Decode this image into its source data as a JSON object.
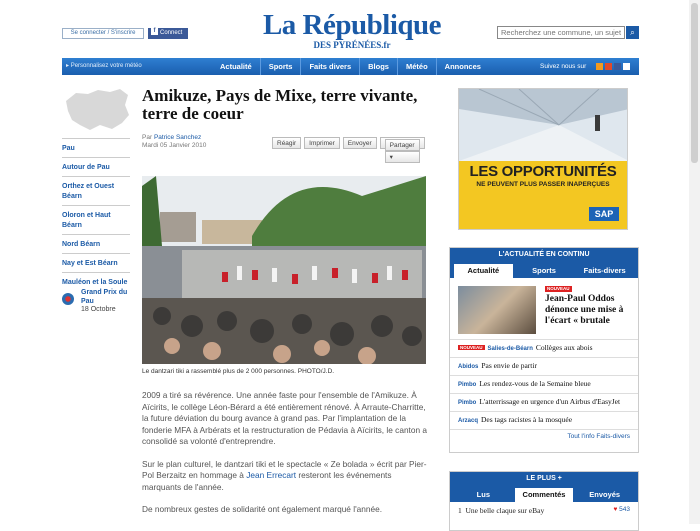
{
  "header": {
    "connect_label": "Se connecter / S'inscrire",
    "fb_connect_label": "Connect",
    "logo_main": "La République",
    "logo_sub": "DES PYRÉNÉES.fr",
    "search_placeholder": "Recherchez une commune, un sujet"
  },
  "nav": {
    "meteo_label": "Personnalisez votre météo",
    "items": [
      "Actualité",
      "Sports",
      "Faits divers",
      "Blogs",
      "Météo",
      "Annonces"
    ],
    "follow_label": "Suivez nous sur"
  },
  "leftnav": {
    "items": [
      "Pau",
      "Autour de Pau",
      "Orthez et Ouest Béarn",
      "Oloron et Haut Béarn",
      "Nord Béarn",
      "Nay et Est Béarn",
      "Mauléon et la Soule"
    ],
    "event_title": "Grand Prix du Pau",
    "event_date": "18 Octobre"
  },
  "article": {
    "title": "Amikuze, Pays de Mixe, terre vivante, terre de coeur",
    "author_prefix": "Par",
    "author": "Patrice Sanchez",
    "date": "Mardi 05 Janvier 2010",
    "tools": [
      "Réagir",
      "Imprimer",
      "Envoyer",
      "Partager"
    ],
    "caption": "Le dantzari tiki a rassemblé plus de 2 000 personnes. PHOTO/J.D.",
    "p1": "2009 a tiré sa révérence. Une année faste pour l'ensemble de l'Amikuze. À Aïcirits, le collège Léon-Bérard a été entièrement rénové. À Arraute-Charritte, la future déviation du bourg avance à grand pas. Par l'implantation de la fonderie MFA à Arbérats et la restructuration de Pédavia à Aïcirits, le canton a consolidé sa volonté d'entreprendre.",
    "p2_a": "Sur le plan culturel, le dantzari tiki et le spectacle « Ze bolada » écrit par Pier-Pol Berzaitz en hommage à ",
    "p2_link": "Jean Errecart",
    "p2_b": " resteront les événements marquants de l'année.",
    "p3": "De nombreux gestes de solidarité ont également marqué l'année."
  },
  "ad": {
    "title": "LES OPPORTUNITÉS",
    "subtitle": "NE PEUVENT PLUS PASSER INAPERÇUES",
    "brand": "SAP"
  },
  "news_box": {
    "header": "L'ACTUALITÉ EN CONTINU",
    "tabs": [
      "Actualité",
      "Sports",
      "Faits-divers"
    ],
    "featured_badge": "NOUVEAU",
    "featured_title": "Jean-Paul Oddos dénonce une mise à l'écart « brutale",
    "rows": [
      {
        "tag": "NOUVEAU",
        "place": "Salies-de-Béarn",
        "text": "Collèges aux abois"
      },
      {
        "tag": "Abidos",
        "text": "Pas envie de partir"
      },
      {
        "tag": "Pimbo",
        "text": "Les rendez-vous de la Semaine bleue"
      },
      {
        "tag": "Pimbo",
        "text": "L'atterrissage en urgence d'un Airbus d'EasyJet"
      },
      {
        "tag": "Arzacq",
        "text": "Des tags racistes à la mosquée"
      }
    ],
    "more_label": "Tout l'info Faits-divers"
  },
  "top_box": {
    "header": "LE PLUS +",
    "tabs": [
      "Lus",
      "Commentés",
      "Envoyés"
    ],
    "first_rank": "1",
    "first_item": "Une belle claque sur eBay",
    "first_count": "543"
  },
  "colors": {
    "brand_blue": "#1b5aa6",
    "accent_red": "#d22222",
    "ad_yellow": "#f3c722"
  }
}
